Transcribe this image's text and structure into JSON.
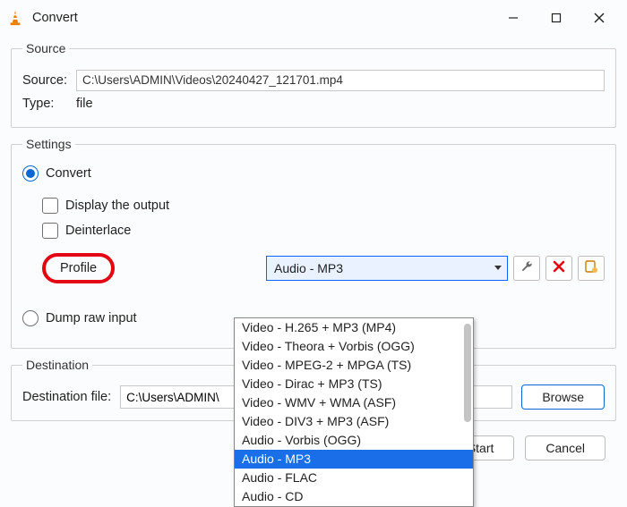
{
  "window": {
    "title": "Convert"
  },
  "source_group": {
    "legend": "Source",
    "source_label": "Source:",
    "source_value": "C:\\Users\\ADMIN\\Videos\\20240427_121701.mp4",
    "type_label": "Type:",
    "type_value": "file"
  },
  "settings_group": {
    "legend": "Settings",
    "convert_label": "Convert",
    "display_output_label": "Display the output",
    "deinterlace_label": "Deinterlace",
    "profile_label": "Profile",
    "profile_selected": "Audio - MP3",
    "profile_options": [
      "Video - H.265 + MP3 (MP4)",
      "Video - Theora + Vorbis (OGG)",
      "Video - MPEG-2 + MPGA (TS)",
      "Video - Dirac + MP3 (TS)",
      "Video - WMV + WMA (ASF)",
      "Video - DIV3 + MP3 (ASF)",
      "Audio - Vorbis (OGG)",
      "Audio - MP3",
      "Audio - FLAC",
      "Audio - CD"
    ],
    "profile_selected_index": 7,
    "dump_raw_label": "Dump raw input"
  },
  "destination_group": {
    "legend": "Destination",
    "dest_file_label": "Destination file:",
    "dest_file_value": "C:\\Users\\ADMIN\\",
    "browse_label": "Browse"
  },
  "footer": {
    "start_label": "Start",
    "cancel_label": "Cancel"
  }
}
